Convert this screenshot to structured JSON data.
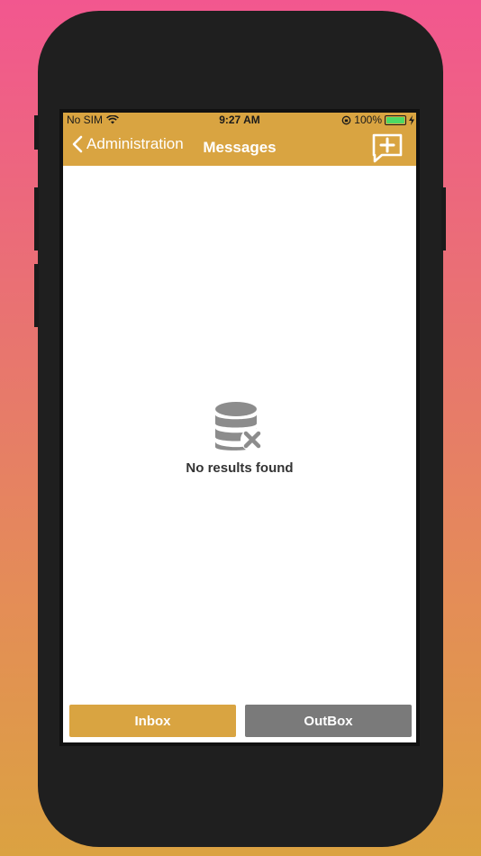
{
  "status": {
    "carrier": "No SIM",
    "time": "9:27 AM",
    "battery": "100%",
    "battery_level": 1.0
  },
  "nav": {
    "back_label": "Administration",
    "title": "Messages",
    "compose_icon": "compose-message-icon"
  },
  "empty_state": {
    "icon": "database-error-icon",
    "text": "No results found"
  },
  "tabs": [
    {
      "label": "Inbox",
      "active": true
    },
    {
      "label": "OutBox",
      "active": false
    }
  ],
  "colors": {
    "accent": "#d9a441",
    "inactive_tab": "#7a7a7a",
    "icon_gray": "#8c8c8c"
  }
}
